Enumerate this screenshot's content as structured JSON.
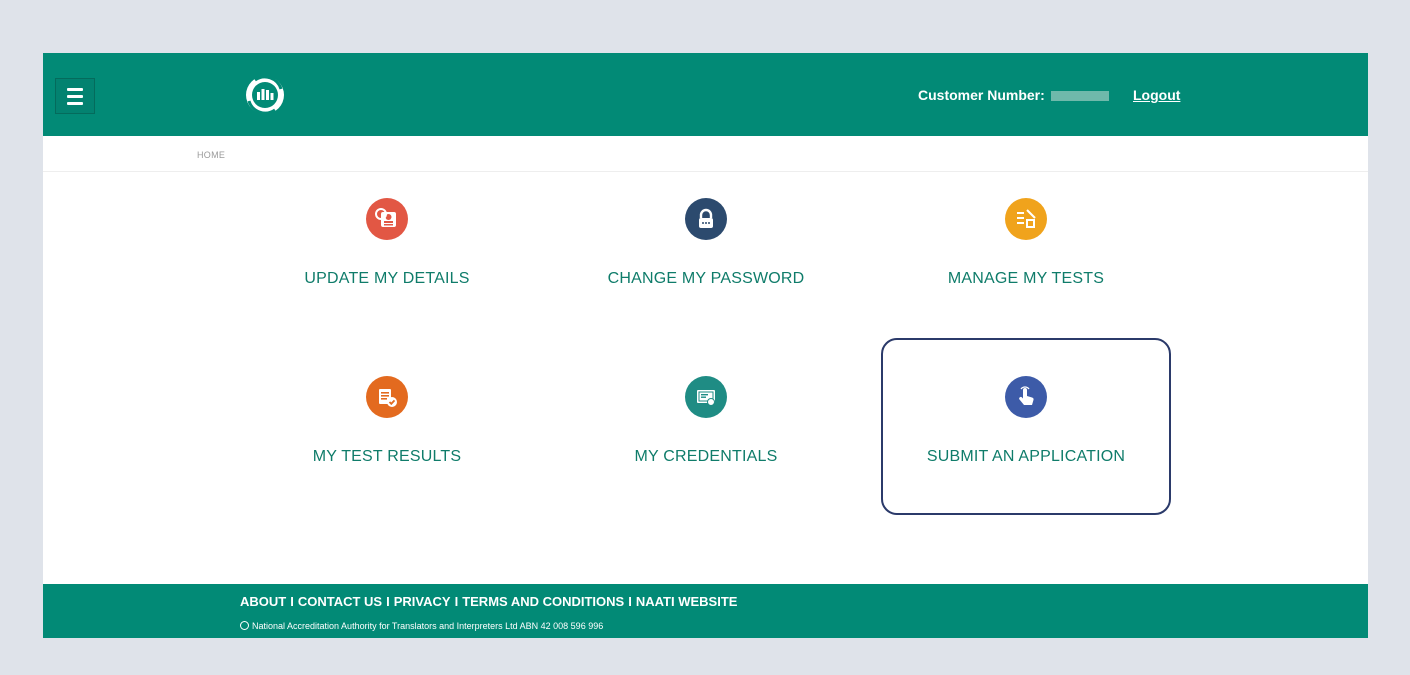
{
  "header": {
    "menu_icon": "hamburger-menu-icon",
    "logo_icon": "naati-logo-icon",
    "customer_label": "Customer Number:",
    "logout_label": "Logout"
  },
  "breadcrumb": {
    "home": "HOME"
  },
  "tiles": [
    {
      "label": "UPDATE MY DETAILS",
      "icon": "id-card-icon",
      "color": "#e25744"
    },
    {
      "label": "CHANGE MY PASSWORD",
      "icon": "padlock-icon",
      "color": "#2c4a6e"
    },
    {
      "label": "MANAGE MY TESTS",
      "icon": "checklist-icon",
      "color": "#f0a31c"
    },
    {
      "label": "MY TEST RESULTS",
      "icon": "document-check-icon",
      "color": "#e36a1f"
    },
    {
      "label": "MY CREDENTIALS",
      "icon": "certificate-icon",
      "color": "#1f8c84"
    },
    {
      "label": "SUBMIT AN APPLICATION",
      "icon": "hand-pointer-icon",
      "color": "#3d5ba8"
    }
  ],
  "footer": {
    "links": [
      "ABOUT",
      "CONTACT US",
      "PRIVACY",
      "TERMS AND CONDITIONS",
      "NAATI WEBSITE"
    ],
    "separator": "I",
    "copyright": "National Accreditation Authority for Translators and Interpreters Ltd ABN 42 008 596 996"
  },
  "colors": {
    "brand": "#028a76",
    "label": "#0f7c6a",
    "highlight_border": "#2b3a6a"
  }
}
